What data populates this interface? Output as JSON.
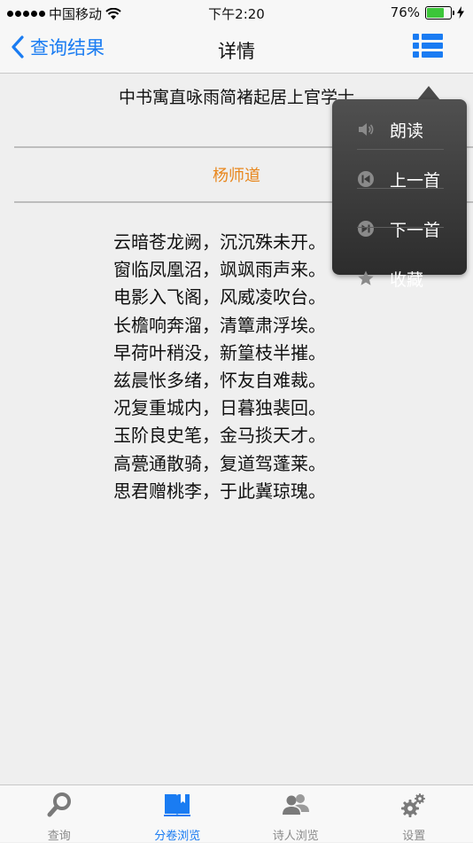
{
  "status_bar": {
    "carrier": "中国移动",
    "time": "下午2:20",
    "battery_percent": "76%",
    "battery_level": 0.76
  },
  "nav": {
    "back_label": "查询结果",
    "title": "详情",
    "list_icon": "list-icon"
  },
  "poem": {
    "title": "中书寓直咏雨简褚起居上官学士",
    "author": "杨师道",
    "lines": [
      "云暗苍龙阙，沉沉殊未开。",
      "窗临凤凰沼，飒飒雨声来。",
      "电影入飞阁，风威凌吹台。",
      "长檐响奔溜，清簟肃浮埃。",
      "早荷叶稍没，新篁枝半摧。",
      "兹晨怅多绪，怀友自难裁。",
      "况复重城内，日暮独裴回。",
      "玉阶良史笔，金马掞天才。",
      "高甍通散骑，复道驾蓬莱。",
      "思君赠桃李，于此冀琼瑰。"
    ]
  },
  "popup_menu": {
    "items": [
      {
        "label": "朗读",
        "icon": "speaker-icon"
      },
      {
        "label": "上一首",
        "icon": "previous-icon"
      },
      {
        "label": "下一首",
        "icon": "next-icon"
      },
      {
        "label": "收藏",
        "icon": "star-icon"
      }
    ]
  },
  "tab_bar": {
    "tabs": [
      {
        "label": "查询",
        "icon": "search-icon"
      },
      {
        "label": "分卷浏览",
        "icon": "book-icon",
        "active": true
      },
      {
        "label": "诗人浏览",
        "icon": "people-icon"
      },
      {
        "label": "设置",
        "icon": "gear-icon"
      }
    ]
  },
  "colors": {
    "accent": "#1a7cf2",
    "author": "#e8871e",
    "background": "#efefef"
  }
}
